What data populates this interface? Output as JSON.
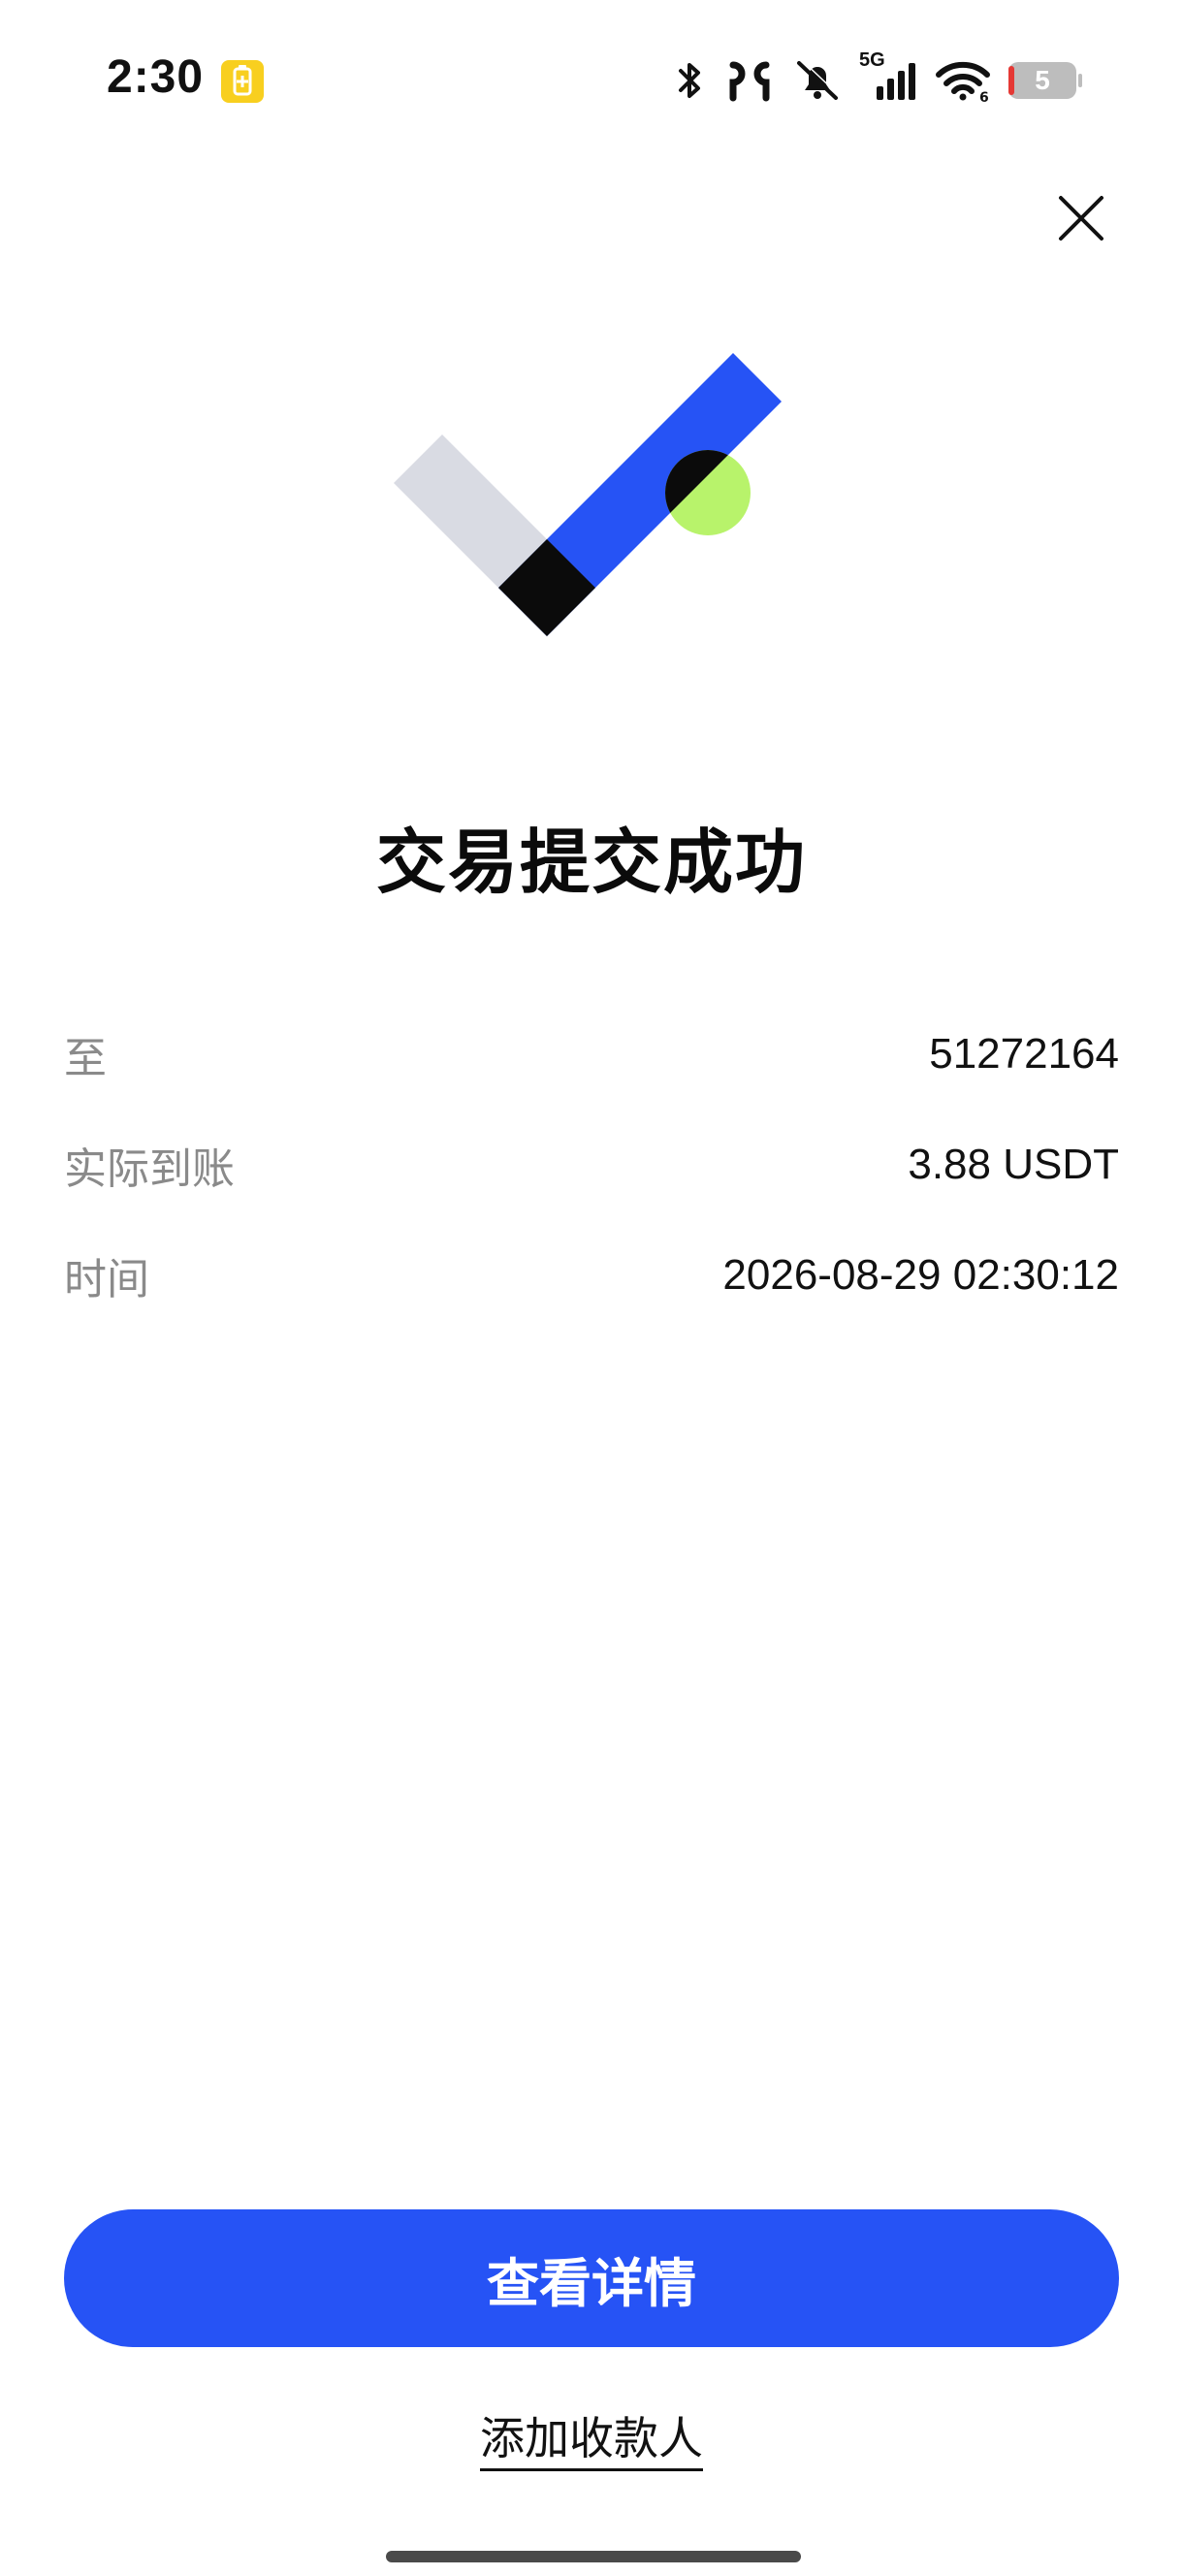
{
  "status_bar": {
    "time": "2:30",
    "network": "5G",
    "battery_level": "5",
    "icons": [
      "battery-saver-icon",
      "bluetooth-icon",
      "earbuds-icon",
      "silent-icon",
      "signal-icon",
      "wifi-icon",
      "battery-icon"
    ]
  },
  "header": {
    "close_icon": "close-icon"
  },
  "result": {
    "title": "交易提交成功",
    "illustration": "success-check-illustration",
    "colors": {
      "check_blue": "#2653f5",
      "check_gray": "#d9dbe3",
      "check_black": "#0b0b0b",
      "dot_green": "#b8f36b"
    }
  },
  "details": [
    {
      "label": "至",
      "value": "51272164"
    },
    {
      "label": "实际到账",
      "value": "3.88 USDT"
    },
    {
      "label": "时间",
      "value": "2026-08-29 02:30:12"
    }
  ],
  "actions": {
    "view_details_label": "查看详情",
    "add_payee_label": "添加收款人"
  },
  "theme": {
    "primary": "#2653f5",
    "label_gray": "#8a8a8a"
  }
}
